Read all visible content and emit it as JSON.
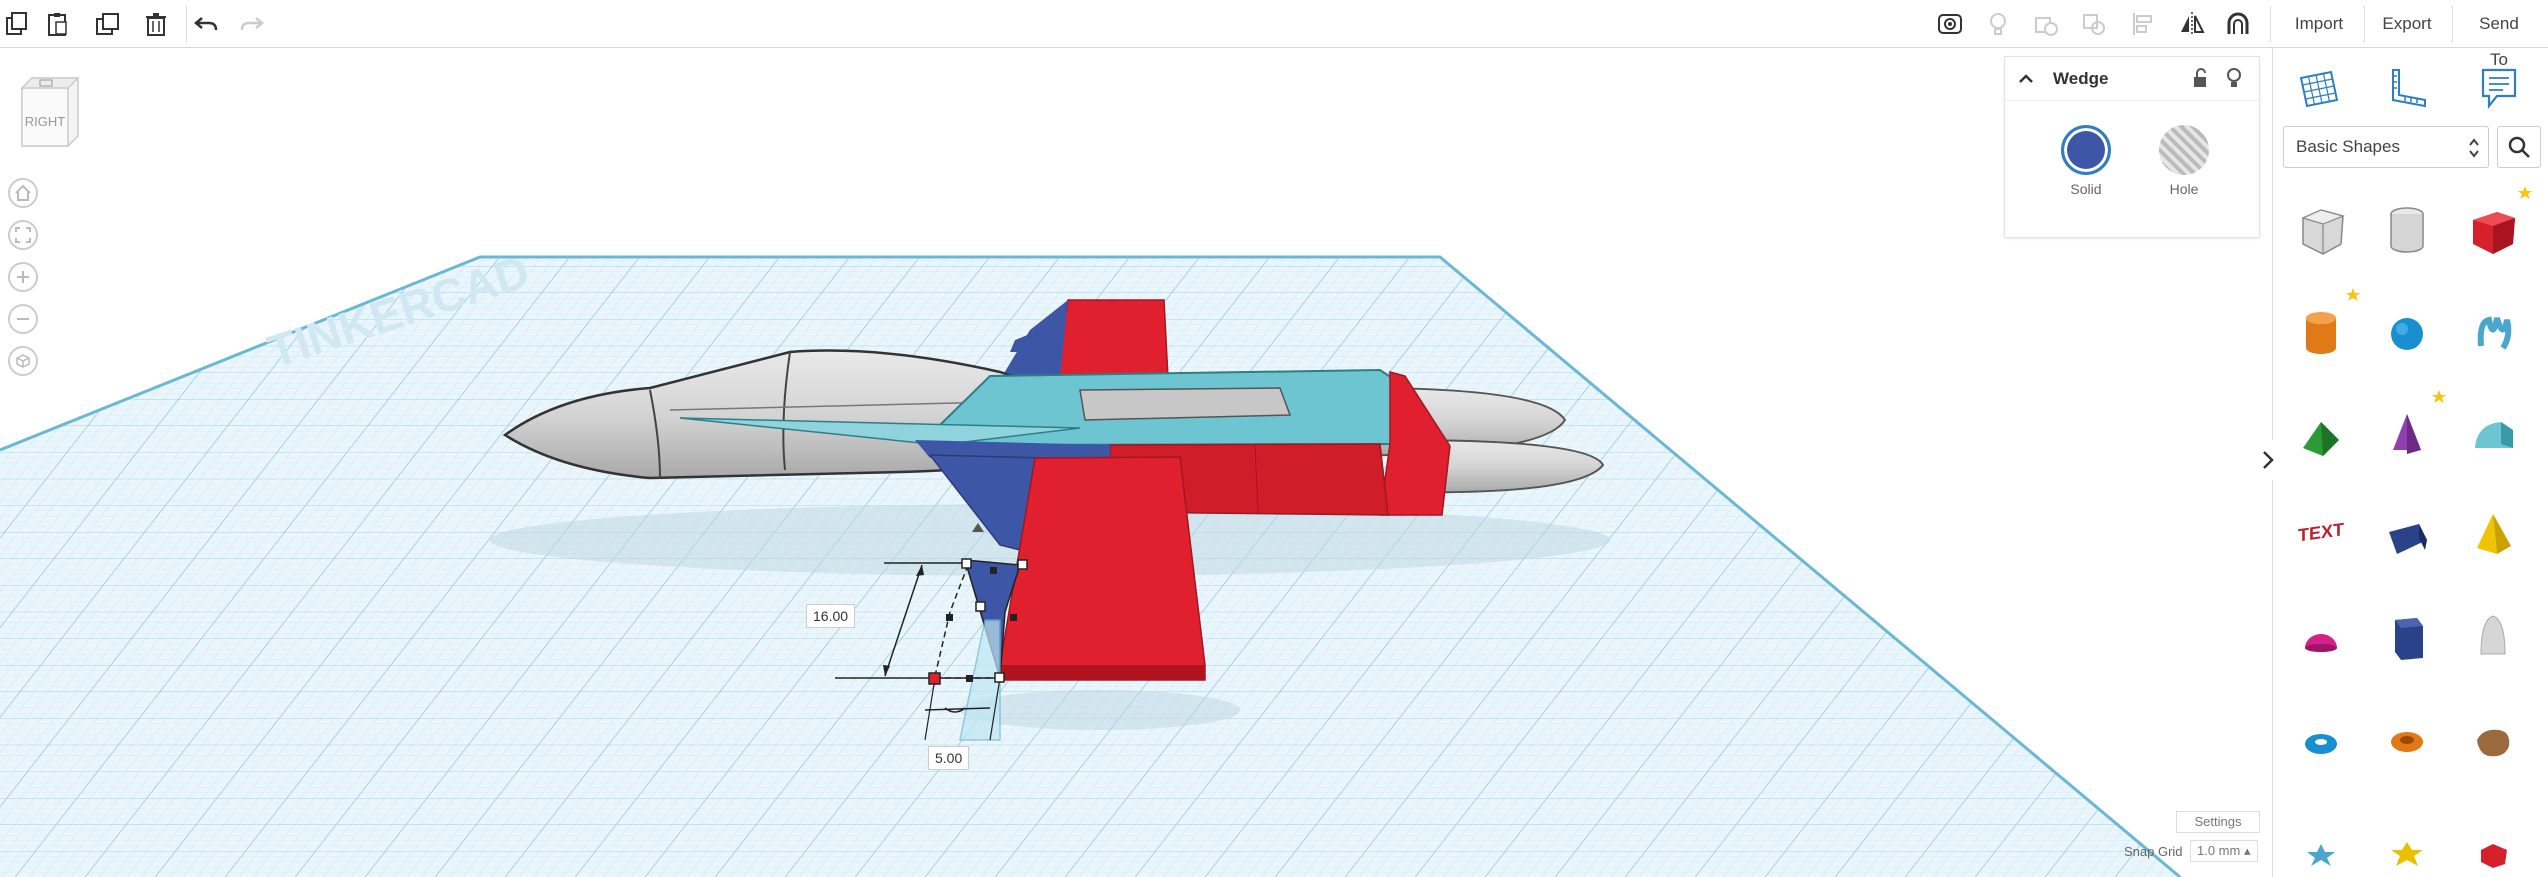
{
  "toolbar": {
    "import_label": "Import",
    "export_label": "Export",
    "send_to_label": "Send To"
  },
  "viewcube": {
    "face_label": "RIGHT"
  },
  "inspector": {
    "title": "Wedge",
    "solid_label": "Solid",
    "hole_label": "Hole",
    "solid_color": "#3d56a6"
  },
  "dimensions": {
    "height_value": "16.00",
    "width_value": "5.00"
  },
  "library": {
    "category": "Basic Shapes",
    "shapes": [
      {
        "name": "box-hole-shape",
        "favorite": false
      },
      {
        "name": "cylinder-hole-shape",
        "favorite": false
      },
      {
        "name": "box-shape",
        "favorite": true
      },
      {
        "name": "cylinder-shape",
        "favorite": true
      },
      {
        "name": "sphere-shape",
        "favorite": false
      },
      {
        "name": "scribble-shape",
        "favorite": false
      },
      {
        "name": "roof-shape",
        "favorite": false
      },
      {
        "name": "cone-shape",
        "favorite": true
      },
      {
        "name": "round-roof-shape",
        "favorite": false
      },
      {
        "name": "text-shape",
        "favorite": false
      },
      {
        "name": "wedge-shape",
        "favorite": false
      },
      {
        "name": "pyramid-shape",
        "favorite": false
      },
      {
        "name": "half-sphere-shape",
        "favorite": false
      },
      {
        "name": "polygon-shape",
        "favorite": false
      },
      {
        "name": "paraboloid-shape",
        "favorite": false
      },
      {
        "name": "torus-shape",
        "favorite": false
      },
      {
        "name": "tube-shape",
        "favorite": false
      },
      {
        "name": "shape-generator-shape",
        "favorite": false
      },
      {
        "name": "star-shape",
        "favorite": false
      },
      {
        "name": "star-gold-shape",
        "favorite": false
      },
      {
        "name": "icosahedron-shape",
        "favorite": false
      }
    ]
  },
  "bottom": {
    "settings_label": "Settings",
    "snap_grid_label": "Snap Grid",
    "snap_grid_value": "1.0 mm ▴"
  },
  "colors": {
    "accent": "#2d7fc1",
    "red": "#e0202e",
    "blue": "#3d56a6",
    "teal": "#6cc5d1",
    "grid": "#9fd3e8"
  }
}
